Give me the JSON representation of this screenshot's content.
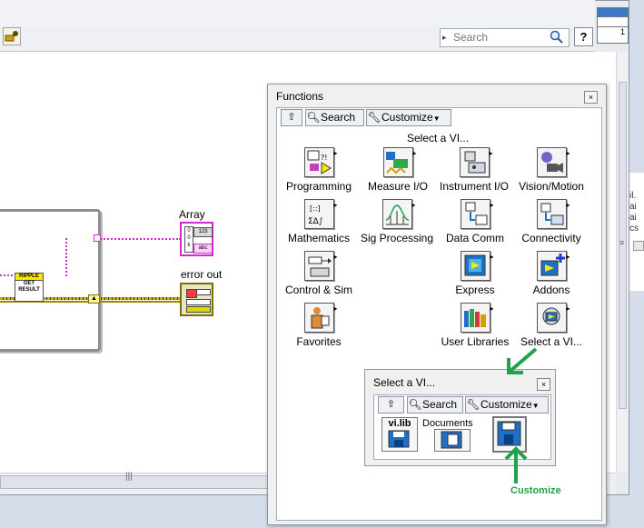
{
  "toolbar": {
    "search_placeholder": "Search",
    "help_label": "?"
  },
  "connector_pane": {
    "value": "1"
  },
  "diagram": {
    "ripple_vi": {
      "line1": "RIPPLE",
      "line2": "GET",
      "line3": "RESULT"
    },
    "array_indicator": {
      "label": "Array",
      "type_text": "123",
      "sub_text": "abc"
    },
    "error_out_indicator": {
      "label": "error out"
    }
  },
  "side_text": [
    "il.",
    "ai",
    "ai",
    "cs"
  ],
  "functions_palette": {
    "title": "Functions",
    "close_label": "×",
    "up_label": "⇧",
    "search_label": "Search",
    "customize_label": "Customize",
    "header": "Select a VI...",
    "categories": [
      {
        "label": "Programming",
        "icon": "programming-icon"
      },
      {
        "label": "Measure I/O",
        "icon": "measure-io-icon"
      },
      {
        "label": "Instrument I/O",
        "icon": "instrument-io-icon"
      },
      {
        "label": "Vision/Motion",
        "icon": "vision-motion-icon"
      },
      {
        "label": "Mathematics",
        "icon": "mathematics-icon"
      },
      {
        "label": "Sig Processing",
        "icon": "signal-processing-icon"
      },
      {
        "label": "Data Comm",
        "icon": "data-comm-icon"
      },
      {
        "label": "Connectivity",
        "icon": "connectivity-icon"
      },
      {
        "label": "Control & Sim",
        "icon": "control-sim-icon"
      },
      {
        "label": "Express",
        "icon": "express-icon"
      },
      {
        "label": "Addons",
        "icon": "addons-icon"
      },
      {
        "label": "Favorites",
        "icon": "favorites-icon"
      },
      {
        "label": "User Libraries",
        "icon": "user-libraries-icon"
      },
      {
        "label": "Select a VI...",
        "icon": "select-vi-icon"
      }
    ]
  },
  "select_vi_popup": {
    "title": "Select a VI...",
    "close_label": "×",
    "up_label": "⇧",
    "search_label": "Search",
    "customize_label": "Customize",
    "items": [
      {
        "label": "vi.lib",
        "icon": "vi-lib-icon"
      },
      {
        "label": "Documents",
        "icon": "documents-icon"
      },
      {
        "label": "",
        "icon": "custom-folder-icon"
      }
    ]
  },
  "annotation": {
    "label": "Customize",
    "color": "#1fa34a"
  }
}
